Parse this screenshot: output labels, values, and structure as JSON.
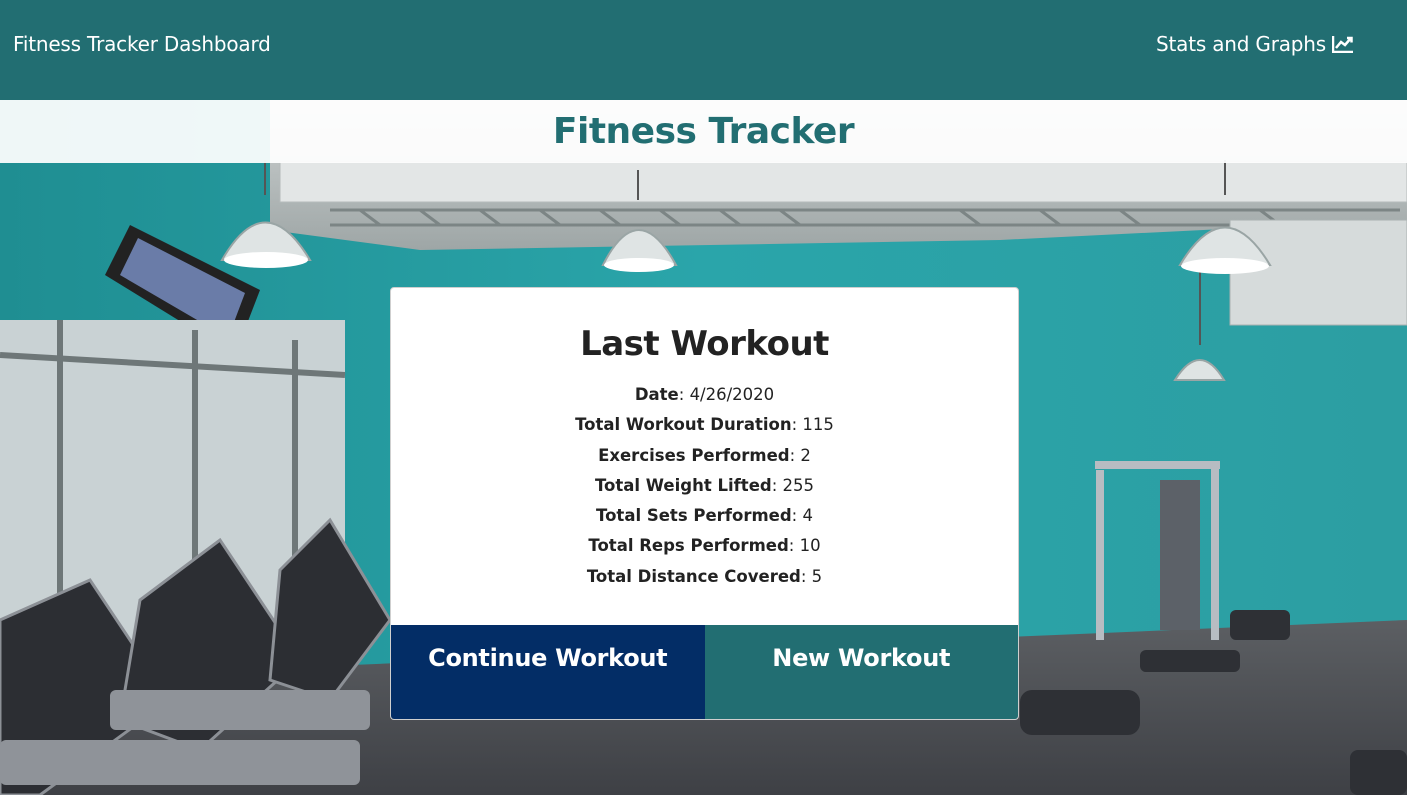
{
  "nav": {
    "brand": "Fitness Tracker Dashboard",
    "stats_link": "Stats and Graphs",
    "stats_icon": "line-chart-icon"
  },
  "banner": {
    "title": "Fitness Tracker"
  },
  "last_workout": {
    "title": "Last Workout",
    "stats": [
      {
        "label": "Date",
        "value": "4/26/2020"
      },
      {
        "label": "Total Workout Duration",
        "value": "115"
      },
      {
        "label": "Exercises Performed",
        "value": "2"
      },
      {
        "label": "Total Weight Lifted",
        "value": "255"
      },
      {
        "label": "Total Sets Performed",
        "value": "4"
      },
      {
        "label": "Total Reps Performed",
        "value": "10"
      },
      {
        "label": "Total Distance Covered",
        "value": "5"
      }
    ],
    "buttons": {
      "continue": "Continue Workout",
      "new": "New Workout"
    }
  },
  "colors": {
    "nav_bg": "#226e72",
    "title_color": "#226e72",
    "continue_bg": "#032d66",
    "new_bg": "#226e72",
    "wall": "#2a9ea2"
  }
}
